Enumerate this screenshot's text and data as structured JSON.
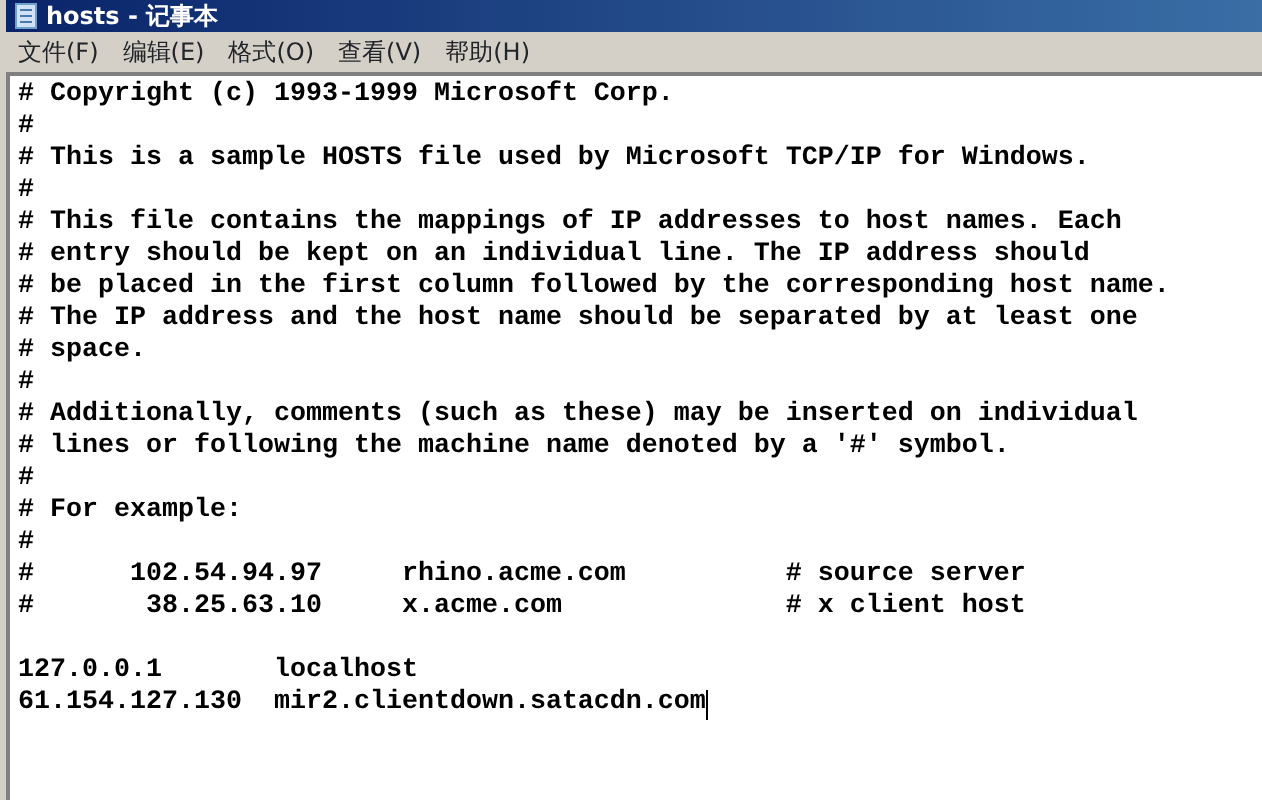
{
  "window": {
    "title": "hosts - 记事本"
  },
  "menu": [
    {
      "label": "文件(F)"
    },
    {
      "label": "编辑(E)"
    },
    {
      "label": "格式(O)"
    },
    {
      "label": "查看(V)"
    },
    {
      "label": "帮助(H)"
    }
  ],
  "lines": [
    {
      "text": "# Copyright (c) 1993-1999 Microsoft Corp."
    },
    {
      "text": "#"
    },
    {
      "text": "# This is a sample HOSTS file used by Microsoft TCP/IP for Windows."
    },
    {
      "text": "#"
    },
    {
      "text": "# This file contains the mappings of IP addresses to host names. Each"
    },
    {
      "text": "# entry should be kept on an individual line. The IP address should"
    },
    {
      "text": "# be placed in the first column followed by the corresponding host name."
    },
    {
      "text": "# The IP address and the host name should be separated by at least one"
    },
    {
      "text": "# space."
    },
    {
      "text": "#"
    },
    {
      "text": "# Additionally, comments (such as these) may be inserted on individual"
    },
    {
      "text": "# lines or following the machine name denoted by a '#' symbol."
    },
    {
      "text": "#"
    },
    {
      "text": "# For example:"
    },
    {
      "text": "#"
    },
    {
      "text": "#      102.54.94.97     rhino.acme.com          # source server"
    },
    {
      "text": "#       38.25.63.10     x.acme.com              # x client host"
    },
    {
      "text": "127.0.0.1       localhost",
      "gap_before": true
    },
    {
      "text": "61.154.127.130  mir2.clientdown.satacdn.com",
      "cursor": true
    }
  ]
}
